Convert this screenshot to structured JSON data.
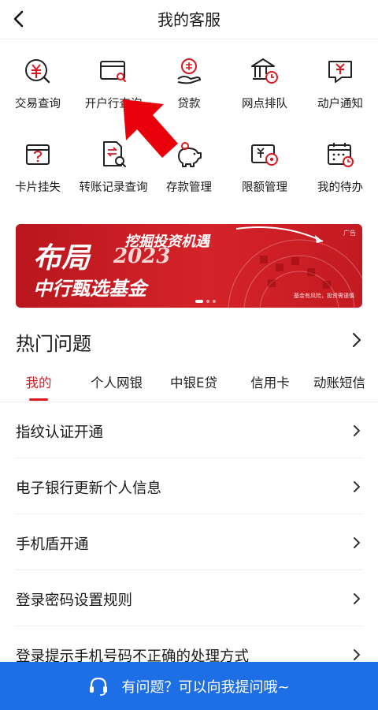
{
  "header": {
    "title": "我的客服"
  },
  "services": [
    {
      "label": "交易查询",
      "icon": "yuan-search-icon"
    },
    {
      "label": "开户行查询",
      "icon": "card-search-icon"
    },
    {
      "label": "贷款",
      "icon": "loan-hand-icon"
    },
    {
      "label": "网点排队",
      "icon": "bank-clock-icon"
    },
    {
      "label": "动户通知",
      "icon": "yuan-notice-icon"
    },
    {
      "label": "卡片挂失",
      "icon": "card-lost-icon"
    },
    {
      "label": "转账记录查询",
      "icon": "transfer-record-icon"
    },
    {
      "label": "存款管理",
      "icon": "piggy-bank-icon"
    },
    {
      "label": "限额管理",
      "icon": "limit-manage-icon"
    },
    {
      "label": "我的待办",
      "icon": "calendar-todo-icon"
    }
  ],
  "banner": {
    "big": "布局",
    "year": "2023",
    "headline": "挖掘投资机遇",
    "sub": "中行甄选基金",
    "ad_tag": "广告",
    "risk": "基金有风险，投资需谨慎"
  },
  "hot": {
    "title": "热门问题"
  },
  "tabs": [
    {
      "label": "我的",
      "active": true
    },
    {
      "label": "个人网银",
      "active": false
    },
    {
      "label": "中银E贷",
      "active": false
    },
    {
      "label": "信用卡",
      "active": false
    },
    {
      "label": "动账短信",
      "active": false
    }
  ],
  "questions": [
    "指纹认证开通",
    "电子银行更新个人信息",
    "手机盾开通",
    "登录密码设置规则",
    "登录提示手机号码不正确的处理方式"
  ],
  "ask_bar": {
    "text": "有问题？可以向我提问哦~"
  },
  "colors": {
    "accent": "#d71920",
    "ask_bar": "#1e6fe6",
    "banner": "#c8202a",
    "arrow": "#e8000b"
  }
}
